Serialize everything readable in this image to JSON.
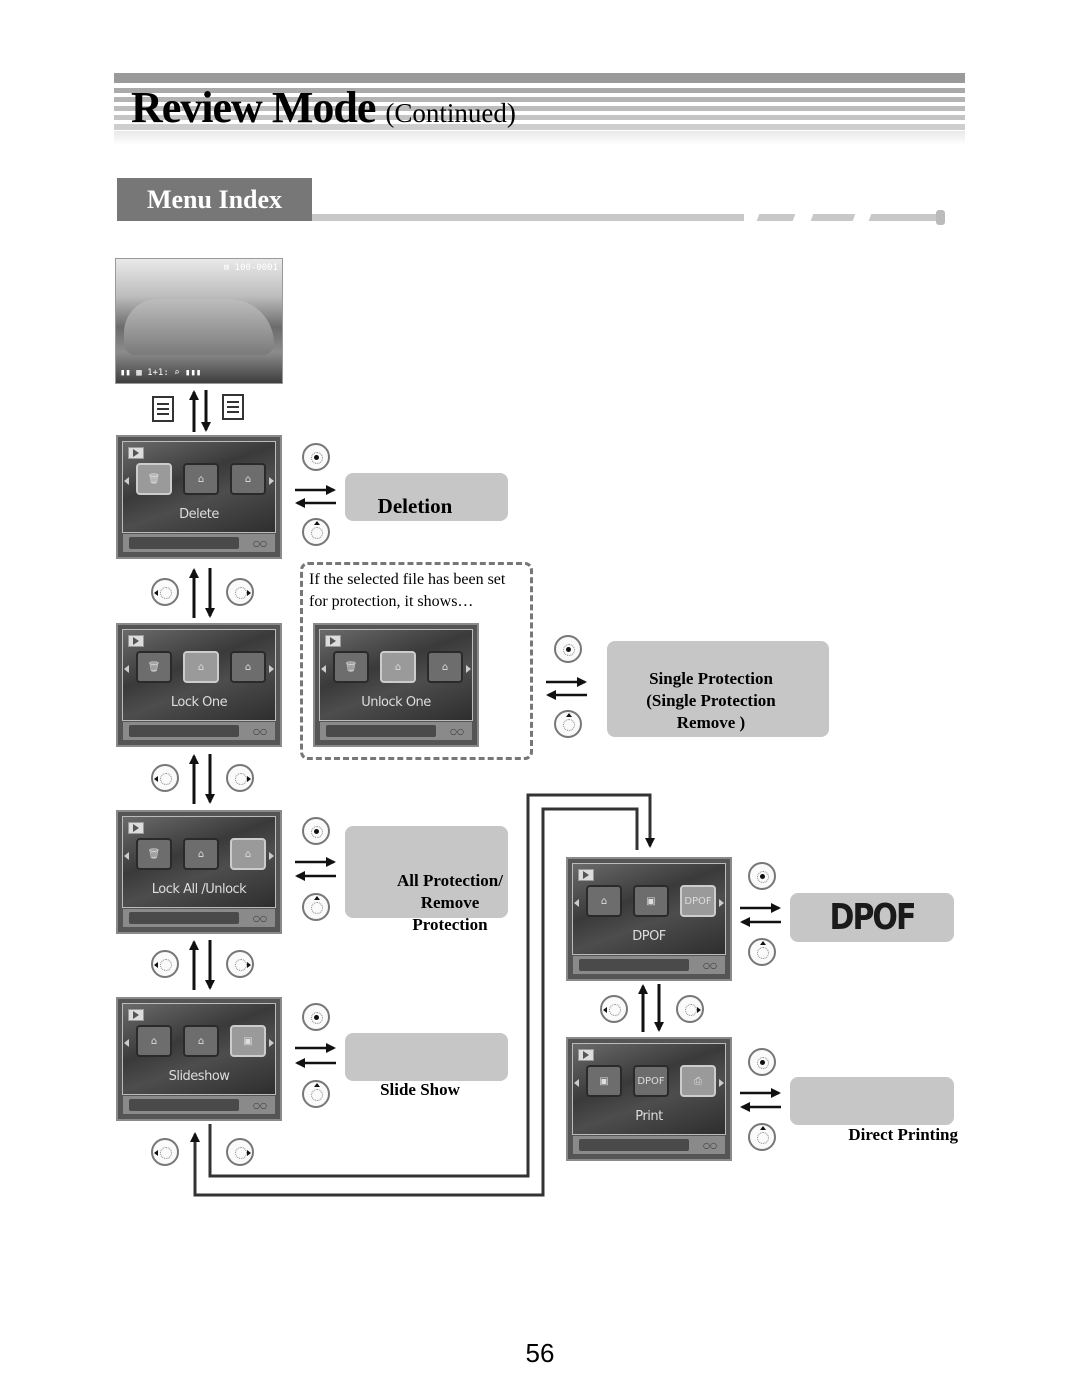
{
  "header": {
    "title": "Review Mode",
    "subtitle": "(Continued)"
  },
  "section": {
    "title": "Menu Index"
  },
  "photo_screen": {
    "top_readout": "⊠ 100-0001",
    "bottom_readout": "▮▮ ▦ 1+1: ⌕ ▮▮▮"
  },
  "screens": [
    {
      "id": "delete",
      "label": "Delete",
      "icons": [
        "🗑",
        "⌂",
        "⌂"
      ],
      "selected": 0
    },
    {
      "id": "lock-one",
      "label": "Lock One",
      "icons": [
        "🗑",
        "⌂",
        "⌂"
      ],
      "selected": 1
    },
    {
      "id": "unlock-one",
      "label": "Unlock One",
      "icons": [
        "🗑",
        "⌂",
        "⌂"
      ],
      "selected": 1
    },
    {
      "id": "lock-all",
      "label": "Lock All /Unlock",
      "icons": [
        "🗑",
        "⌂",
        "⌂"
      ],
      "selected": 2
    },
    {
      "id": "slideshow",
      "label": "Slideshow",
      "icons": [
        "⌂",
        "⌂",
        "▣"
      ],
      "selected": 2
    },
    {
      "id": "dpof",
      "label": "DPOF",
      "icons": [
        "⌂",
        "▣",
        "DPOF"
      ],
      "selected": 2
    },
    {
      "id": "print",
      "label": "Print",
      "icons": [
        "▣",
        "DPOF",
        "⎙"
      ],
      "selected": 2
    }
  ],
  "screen_bar_dots": "○○",
  "functions": {
    "deletion": "Deletion",
    "single_protection": [
      "Single Protection",
      "(Single Protection",
      "Remove )"
    ],
    "all_protection": [
      "All Protection/",
      "Remove",
      "Protection"
    ],
    "slide_show": "Slide Show",
    "dpof": "DPOF",
    "direct_printing": "Direct Printing"
  },
  "note": [
    "If the selected file has been set",
    "for protection, it shows…"
  ],
  "page_number": "56",
  "colors": {
    "stripe_dark": "#9a9a9a",
    "tab_bg": "#777777",
    "label_box": "#c6c6c6",
    "dashed_border": "#777777"
  }
}
